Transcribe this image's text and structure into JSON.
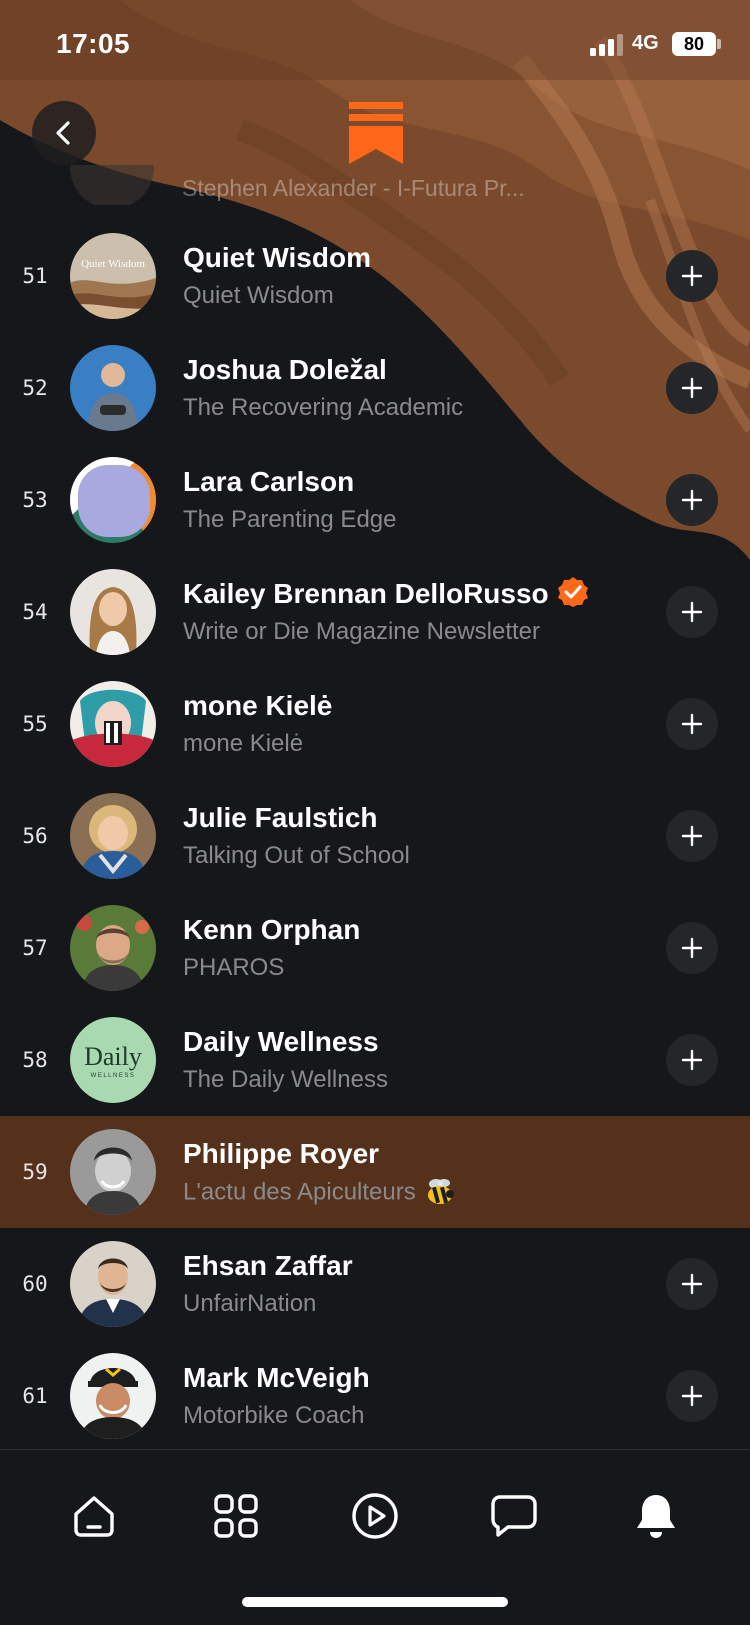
{
  "status_bar": {
    "time": "17:05",
    "network": "4G",
    "battery": "80"
  },
  "colors": {
    "accent": "#ff6719",
    "highlight_row": "#55301a",
    "background": "#16171a"
  },
  "icons": {
    "back": "chevron-left-icon",
    "logo": "substack-logo",
    "follow": "plus-icon",
    "verified": "verified-badge-icon",
    "tabs": [
      "home-icon",
      "grid-icon",
      "play-icon",
      "chat-icon",
      "bell-icon"
    ]
  },
  "partial_row": {
    "subtitle": "Stephen Alexander - I-Futura Pr..."
  },
  "list": [
    {
      "rank": "51",
      "name": "Quiet Wisdom",
      "publication": "Quiet Wisdom",
      "verified": false,
      "highlighted": false
    },
    {
      "rank": "52",
      "name": "Joshua Doležal",
      "publication": "The Recovering Academic",
      "verified": false,
      "highlighted": false
    },
    {
      "rank": "53",
      "name": "Lara Carlson",
      "publication": "The Parenting Edge",
      "verified": false,
      "highlighted": false
    },
    {
      "rank": "54",
      "name": "Kailey Brennan DelloRusso",
      "publication": "Write or Die Magazine Newsletter",
      "verified": true,
      "highlighted": false
    },
    {
      "rank": "55",
      "name": "mone Kielė",
      "publication": "mone Kielė",
      "verified": false,
      "highlighted": false
    },
    {
      "rank": "56",
      "name": "Julie Faulstich",
      "publication": "Talking Out of School",
      "verified": false,
      "highlighted": false
    },
    {
      "rank": "57",
      "name": "Kenn Orphan",
      "publication": "PHAROS",
      "verified": false,
      "highlighted": false
    },
    {
      "rank": "58",
      "name": "Daily Wellness",
      "publication": "The Daily Wellness",
      "verified": false,
      "highlighted": false
    },
    {
      "rank": "59",
      "name": "Philippe Royer",
      "publication": "L'actu des Apiculteurs",
      "verified": false,
      "highlighted": true
    },
    {
      "rank": "60",
      "name": "Ehsan Zaffar",
      "publication": "UnfairNation",
      "verified": false,
      "highlighted": false
    },
    {
      "rank": "61",
      "name": "Mark McVeigh",
      "publication": "Motorbike Coach",
      "verified": false,
      "highlighted": false
    }
  ],
  "avatar_text": {
    "quiet_wisdom": "Quiet Wisdom",
    "daily_main": "Daily",
    "daily_sub": "WELLNESS"
  }
}
